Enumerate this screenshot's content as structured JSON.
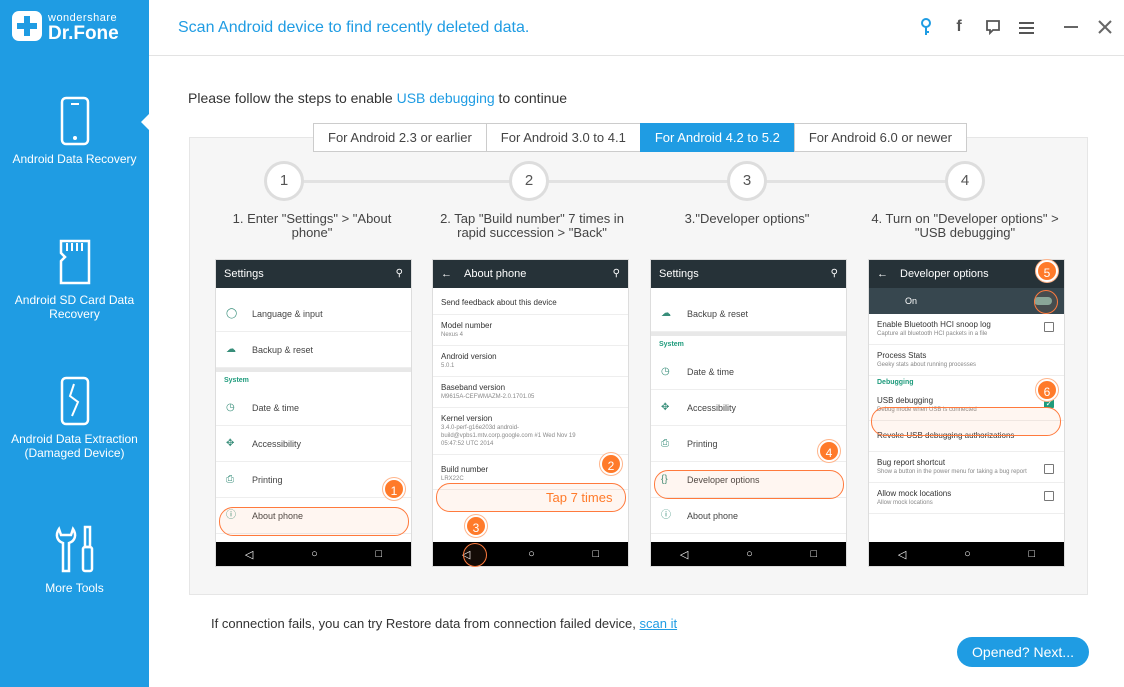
{
  "brand": {
    "top": "wondershare",
    "bottom": "Dr.Fone"
  },
  "header": {
    "title": "Scan Android device to find recently deleted data."
  },
  "sidebar": {
    "items": [
      {
        "label": "Android Data Recovery"
      },
      {
        "label": "Android SD Card Data Recovery"
      },
      {
        "label": "Android Data Extraction (Damaged Device)"
      },
      {
        "label": "More Tools"
      }
    ]
  },
  "instruction": {
    "prefix": "Please follow the steps to enable ",
    "link": "USB debugging",
    "suffix": " to continue"
  },
  "tabs": [
    "For Android 2.3 or earlier",
    "For Android 3.0 to 4.1",
    "For Android 4.2 to 5.2",
    "For Android 6.0 or newer"
  ],
  "active_tab": "For Android 4.2 to 5.2",
  "steps": [
    {
      "num": "1",
      "text": "1. Enter \"Settings\" > \"About phone\""
    },
    {
      "num": "2",
      "text": "2. Tap \"Build number\" 7   times in rapid succession > \"Back\""
    },
    {
      "num": "3",
      "text": "3.\"Developer options\""
    },
    {
      "num": "4",
      "text": "4. Turn on \"Developer options\" > \"USB debugging\""
    }
  ],
  "phone1": {
    "title": "Settings",
    "rows": [
      "Language & input",
      "Backup & reset"
    ],
    "section": "System",
    "rows2": [
      "Date & time",
      "Accessibility",
      "Printing",
      "About phone"
    ],
    "badge": "1"
  },
  "phone2": {
    "title": "About phone",
    "items": [
      {
        "t": "Send feedback about this device",
        "s": ""
      },
      {
        "t": "Model number",
        "s": "Nexus 4"
      },
      {
        "t": "Android version",
        "s": "5.0.1"
      },
      {
        "t": "Baseband version",
        "s": "M9615A-CEFWMAZM-2.0.1701.05"
      },
      {
        "t": "Kernel version",
        "s": "3.4.0-perf-g16e203d android-build@vpbs1.mtv.corp.google.com #1 Wed Nov 19 05:47:52 UTC 2014"
      },
      {
        "t": "Build number",
        "s": "LRX22C"
      }
    ],
    "tap_label": "Tap 7 times",
    "badge2": "2",
    "badge3": "3"
  },
  "phone3": {
    "title": "Settings",
    "rows": [
      "Backup & reset"
    ],
    "section": "System",
    "rows2": [
      "Date & time",
      "Accessibility",
      "Printing",
      "Developer options",
      "About phone"
    ],
    "badge": "4"
  },
  "phone4": {
    "title": "Developer options",
    "on_label": "On",
    "items": [
      {
        "t": "Enable Bluetooth HCI snoop log",
        "s": "Capture all bluetooth HCI packets in a file"
      },
      {
        "t": "Process Stats",
        "s": "Geeky stats about running processes"
      }
    ],
    "section": "Debugging",
    "usb": {
      "t": "USB debugging",
      "s": "Debug mode when USB is connected"
    },
    "items2": [
      {
        "t": "Revoke USB debugging authorizations",
        "s": ""
      },
      {
        "t": "Bug report shortcut",
        "s": "Show a button in the power menu for taking a bug report"
      },
      {
        "t": "Allow mock locations",
        "s": "Allow mock locations"
      }
    ],
    "badge5": "5",
    "badge6": "6"
  },
  "footer": {
    "text": "If connection fails, you can try Restore data from connection failed device, ",
    "link": "scan it"
  },
  "next_button": "Opened? Next...",
  "colors": {
    "accent": "#1f9ce3",
    "highlight": "#ff7a2a",
    "phone_header": "#263238"
  }
}
